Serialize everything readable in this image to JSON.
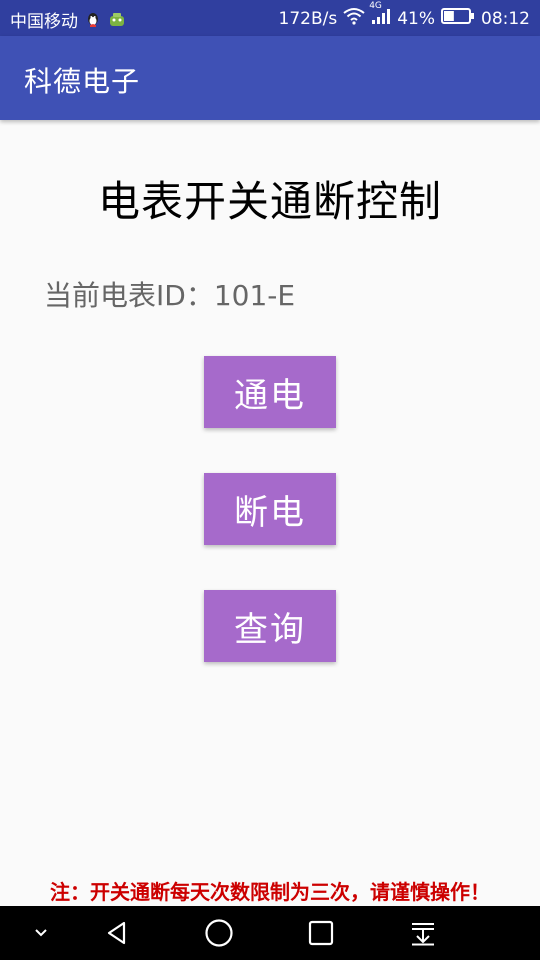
{
  "status_bar": {
    "carrier": "中国移动",
    "net_speed": "172B/s",
    "net_type": "4G",
    "battery_percent": "41%",
    "battery_level": 0.41,
    "time": "08:12"
  },
  "app_bar": {
    "title": "科德电子"
  },
  "main": {
    "heading": "电表开关通断控制",
    "meter_label": "当前电表ID：101-E",
    "buttons": {
      "power_on": "通电",
      "power_off": "断电",
      "query": "查询"
    },
    "notice": "注：开关通断每天次数限制为三次，请谨慎操作！"
  },
  "icons": {
    "status": [
      "qq-icon",
      "app-notification-icon",
      "wifi-icon",
      "signal-icon",
      "battery-icon"
    ],
    "nav": [
      "collapse-icon",
      "back-icon",
      "home-icon",
      "recents-icon",
      "notification-pull-icon"
    ]
  },
  "colors": {
    "status_bar": "#303f9f",
    "app_bar": "#3f51b5",
    "button": "#a66acb",
    "notice": "#cc0000",
    "nav_bar": "#000000"
  }
}
